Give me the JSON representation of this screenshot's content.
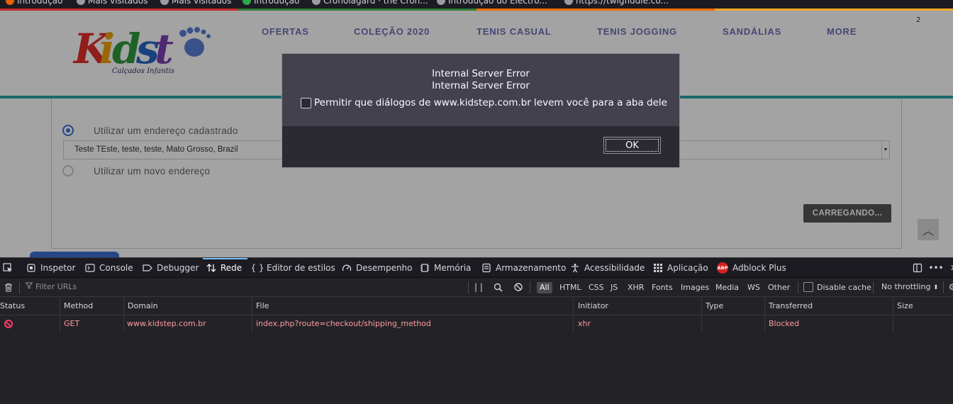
{
  "browser": {
    "bookmarks": [
      {
        "label": "Introdução"
      },
      {
        "label": "Mais visitados"
      },
      {
        "label": "Mais visitados"
      },
      {
        "label": "Introdução"
      },
      {
        "label": "Cronolâgard · the Cron..."
      },
      {
        "label": "Introdução do Electro..."
      },
      {
        "label": "https://twigfiddle.co..."
      }
    ]
  },
  "site": {
    "logo_text": "Kidstep",
    "logo_sub": "Calçados Infantis",
    "nav": [
      "OFERTAS",
      "COLEÇÃO 2020",
      "TENIS CASUAL",
      "TENIS JOGGING",
      "SANDÁLIAS",
      "MORE"
    ],
    "cart_count": "2",
    "checkout": {
      "option_existing": "Utilizar um endereço cadastrado",
      "selected_address": "Teste TEste, teste, teste, Mato Grosso, Brazil",
      "option_new": "Utilizar um novo endereço",
      "loading_label": "CARREGANDO..."
    }
  },
  "dialog": {
    "line1": "Internal Server Error",
    "line2": "Internal Server Error",
    "checkbox_label": "Permitir que diálogos de www.kidstep.com.br levem você para a aba dele",
    "ok_label": "OK"
  },
  "devtools": {
    "tabs": [
      {
        "label": "Inspetor",
        "icon": "inspector-icon"
      },
      {
        "label": "Console",
        "icon": "console-icon"
      },
      {
        "label": "Debugger",
        "icon": "debugger-icon"
      },
      {
        "label": "Rede",
        "icon": "network-icon",
        "selected": true
      },
      {
        "label": "Editor de estilos",
        "icon": "style-editor-icon"
      },
      {
        "label": "Desempenho",
        "icon": "performance-icon"
      },
      {
        "label": "Memória",
        "icon": "memory-icon"
      },
      {
        "label": "Armazenamento",
        "icon": "storage-icon"
      },
      {
        "label": "Acessibilidade",
        "icon": "accessibility-icon"
      },
      {
        "label": "Aplicação",
        "icon": "application-icon"
      },
      {
        "label": "Adblock Plus",
        "icon": "adblock-plus-icon",
        "badge": "ABP"
      }
    ],
    "filter_placeholder": "Filter URLs",
    "filter_types": [
      "All",
      "HTML",
      "CSS",
      "JS",
      "XHR",
      "Fonts",
      "Images",
      "Media",
      "WS",
      "Other"
    ],
    "selected_filter": "All",
    "disable_cache_label": "Disable cache",
    "throttling_label": "No throttling",
    "columns": [
      "Status",
      "Method",
      "Domain",
      "File",
      "Initiator",
      "Type",
      "Transferred",
      "Size"
    ],
    "rows": [
      {
        "status": "blocked",
        "method": "GET",
        "domain": "www.kidstep.com.br",
        "file": "index.php?route=checkout/shipping_method",
        "initiator": "xhr",
        "type": "",
        "transferred": "Blocked",
        "size": ""
      }
    ]
  },
  "colors": {
    "accent_teal": "#2aa7a9",
    "nav_purple": "#6b6fb3",
    "devtools_bg": "#232327",
    "blocked_red": "#ff9aa2",
    "selected_tab_blue": "#75bfff"
  }
}
